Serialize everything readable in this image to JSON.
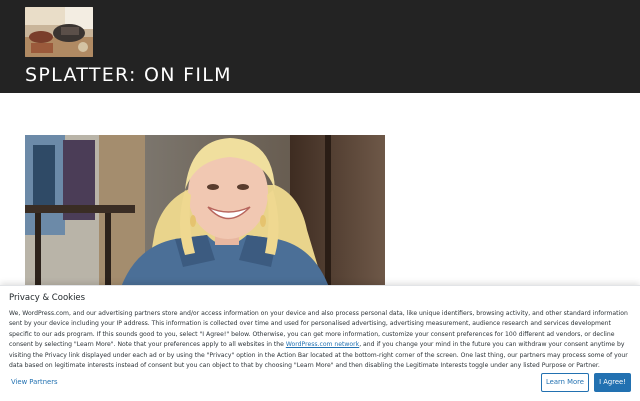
{
  "header": {
    "site_title": "SPLATTER: ON FILM",
    "background": "#232323"
  },
  "featured_image": {
    "alt": "Photo of a smiling blonde woman in a denim jacket"
  },
  "cookie_banner": {
    "title": "Privacy & Cookies",
    "text_part1": "We, WordPress.com, and our advertising partners store and/or access information on your device and also process personal data, like unique identifiers, browsing activity, and other standard information sent by your device including your IP address. This information is collected over time and used for personalised advertising, advertising measurement, audience research and services development specific to our ads program. If this sounds good to you, select \"I Agree!\" below. Otherwise, you can get more information, customize your consent preferences for 100 different ad vendors, or decline consent by selecting \"Learn More\". Note that your preferences apply to all websites in the ",
    "link_text": "WordPress.com network",
    "text_part2": ", and if you change your mind in the future you can withdraw your consent anytime by visiting the Privacy link displayed under each ad or by using the \"Privacy\" option in the Action Bar located at the bottom-right corner of the screen. One last thing, our partners may process some of your data based on legitimate interests instead of consent but you can object to that by choosing \"Learn More\" and then disabling the Legitimate Interests toggle under any listed Purpose or Partner.",
    "view_partners_label": "View Partners",
    "learn_more_label": "Learn More",
    "agree_label": "I Agree!",
    "accent_color": "#2271b1"
  }
}
